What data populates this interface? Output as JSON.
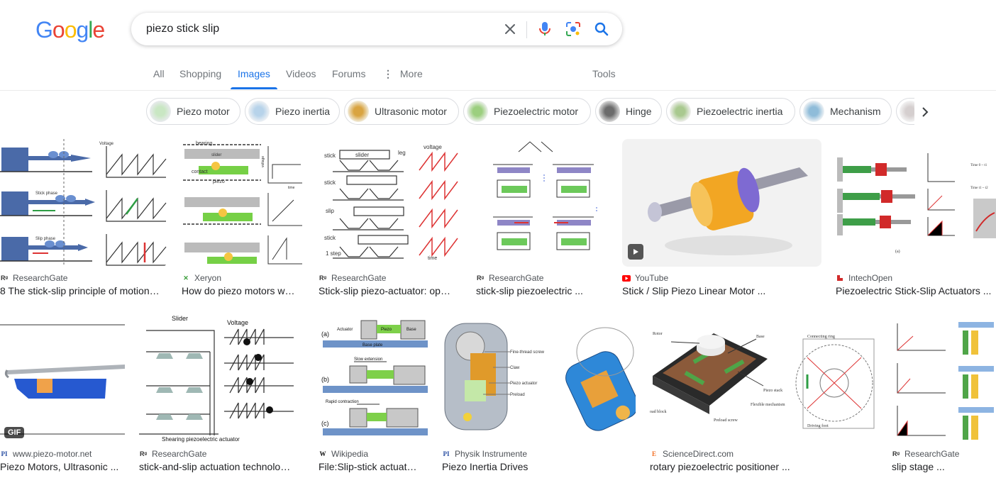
{
  "colors": {
    "accent": "#1a73e8",
    "text": "#202124",
    "muted": "#70757a"
  },
  "logo": {
    "letters": [
      "G",
      "o",
      "o",
      "g",
      "l",
      "e"
    ],
    "colors": [
      "#4285f4",
      "#ea4335",
      "#fbbc05",
      "#4285f4",
      "#34a853",
      "#ea4335"
    ]
  },
  "search": {
    "query": "piezo stick slip",
    "icons": [
      "close-icon",
      "microphone-icon",
      "lens-icon",
      "search-icon"
    ]
  },
  "tabs": [
    {
      "label": "All"
    },
    {
      "label": "Shopping"
    },
    {
      "label": "Images",
      "active": true
    },
    {
      "label": "Videos"
    },
    {
      "label": "Forums"
    },
    {
      "label": "More"
    }
  ],
  "tools_label": "Tools",
  "chips": [
    {
      "label": "Piezo motor"
    },
    {
      "label": "Piezo inertia"
    },
    {
      "label": "Ultrasonic motor"
    },
    {
      "label": "Piezoelectric motor"
    },
    {
      "label": "Hinge"
    },
    {
      "label": "Piezoelectric inertia"
    },
    {
      "label": "Mechanism"
    }
  ],
  "results_row1": [
    {
      "source": "ResearchGate",
      "title": "8 The stick-slip principle of motion…",
      "icon": "researchgate-icon"
    },
    {
      "source": "Xeryon",
      "title": "How do piezo motors w…",
      "icon": "xeryon-icon"
    },
    {
      "source": "ResearchGate",
      "title": "Stick-slip piezo-actuator: op…",
      "icon": "researchgate-icon"
    },
    {
      "source": "ResearchGate",
      "title": "stick-slip piezoelectric ...",
      "icon": "researchgate-icon"
    },
    {
      "source": "YouTube",
      "title": "Stick / Slip Piezo Linear Motor ...",
      "icon": "youtube-icon"
    },
    {
      "source": "IntechOpen",
      "title": "Piezoelectric Stick-Slip Actuators ...",
      "icon": "intechopen-icon"
    }
  ],
  "results_row2": [
    {
      "source": "www.piezo-motor.net",
      "title": "Piezo Motors, Ultrasonic ...",
      "icon": "pi-icon",
      "badge": "GIF"
    },
    {
      "source": "ResearchGate",
      "title": "stick-and-slip actuation technolo…",
      "icon": "researchgate-icon"
    },
    {
      "source": "Wikipedia",
      "title": "File:Slip-stick actuat…",
      "icon": "wikipedia-icon"
    },
    {
      "source": "Physik Instrumente",
      "title": "Piezo Inertia Drives",
      "icon": "pi-icon"
    },
    {
      "source": "ScienceDirect.com",
      "title": "rotary piezoelectric positioner ...",
      "icon": "sciencedirect-icon"
    },
    {
      "source": "ResearchGate",
      "title": "slip stage ...",
      "icon": "researchgate-icon"
    }
  ],
  "image_text": {
    "r1c1": [
      "Voltage",
      "Stick phase",
      "Slip phase"
    ],
    "r1c2": [
      "bearing",
      "slider",
      "contact",
      "piezo",
      "voltage",
      "time"
    ],
    "r1c3": [
      "stick",
      "slider",
      "leg",
      "voltage",
      "stick",
      "slip",
      "stick",
      "1 step",
      "time"
    ],
    "r1c6": [
      "Time 0 ~ t1",
      "Time t1 ~ t2",
      "(a)"
    ],
    "r2c2": [
      "Slider",
      "Voltage",
      "Shearing piezoelectric actuator"
    ],
    "r2c3": [
      "(a)",
      "Actuator",
      "Piezo",
      "Base",
      "Base plate",
      "(b)",
      "Slow extension",
      "(c)",
      "Rapid contraction"
    ],
    "r2c4": [
      "Fine-thread screw",
      "Claw",
      "Piezo actuator",
      "Preload"
    ],
    "r2c5": [
      "Rotor",
      "Base",
      "Piezo stack",
      "Flexible mechanism",
      "Preload screw",
      "oad block",
      "Connecting ring",
      "Driving foot"
    ]
  }
}
